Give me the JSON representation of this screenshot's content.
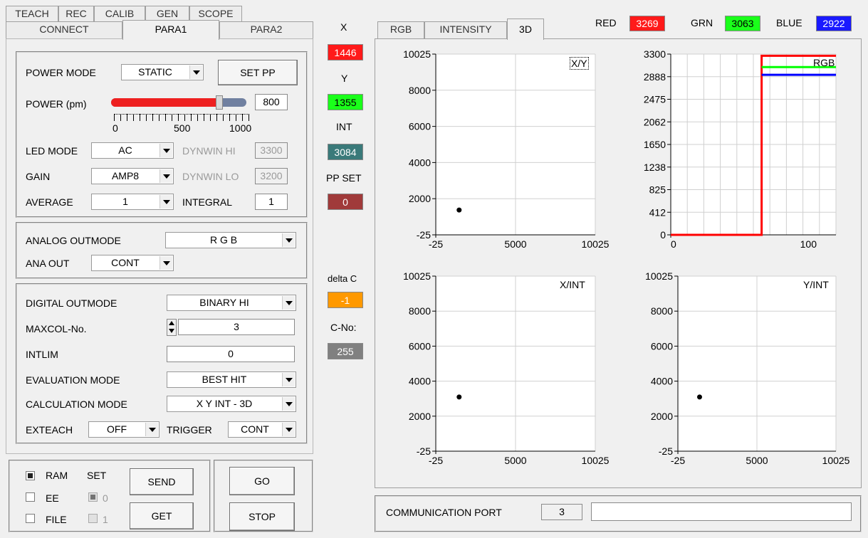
{
  "tabs_top": [
    "TEACH",
    "REC",
    "CALIB",
    "GEN",
    "SCOPE"
  ],
  "tabs_bottom": [
    "CONNECT",
    "PARA1",
    "PARA2"
  ],
  "para1": {
    "power_mode_label": "POWER MODE",
    "power_mode_value": "STATIC",
    "set_pp_label": "SET PP",
    "power_label": "POWER (pm)",
    "power_value": "800",
    "power_fraction": 0.8,
    "slider_ticks": [
      "0",
      "500",
      "1000"
    ],
    "led_mode_label": "LED MODE",
    "led_mode_value": "AC",
    "dynwin_hi_label": "DYNWIN HI",
    "dynwin_hi_value": "3300",
    "gain_label": "GAIN",
    "gain_value": "AMP8",
    "dynwin_lo_label": "DYNWIN LO",
    "dynwin_lo_value": "3200",
    "average_label": "AVERAGE",
    "average_value": "1",
    "integral_label": "INTEGRAL",
    "integral_value": "1"
  },
  "analog": {
    "outmode_label": "ANALOG OUTMODE",
    "outmode_value": "R G B",
    "anaout_label": "ANA OUT",
    "anaout_value": "CONT"
  },
  "digital": {
    "outmode_label": "DIGITAL OUTMODE",
    "outmode_value": "BINARY HI",
    "maxcol_label": "MAXCOL-No.",
    "maxcol_value": "3",
    "intlim_label": "INTLIM",
    "intlim_value": "0",
    "eval_label": "EVALUATION MODE",
    "eval_value": "BEST HIT",
    "calc_label": "CALCULATION MODE",
    "calc_value": "X Y INT - 3D",
    "exteach_label": "EXTEACH",
    "exteach_value": "OFF",
    "trigger_label": "TRIGGER",
    "trigger_value": "CONT"
  },
  "bottom": {
    "ram": "RAM",
    "ee": "EE",
    "file": "FILE",
    "set": "SET",
    "set0": "0",
    "set1": "1",
    "send": "SEND",
    "get": "GET",
    "go": "GO",
    "stop": "STOP"
  },
  "readouts": {
    "x_label": "X",
    "x_value": "1446",
    "y_label": "Y",
    "y_value": "1355",
    "int_label": "INT",
    "int_value": "3084",
    "ppset_label": "PP SET",
    "ppset_value": "0",
    "deltac_label": "delta C",
    "deltac_value": "-1",
    "cno_label": "C-No:",
    "cno_value": "255"
  },
  "right_tabs": [
    "RGB",
    "INTENSITY",
    "3D"
  ],
  "rgb_header": {
    "red_label": "RED",
    "red_value": "3269",
    "grn_label": "GRN",
    "grn_value": "3063",
    "blue_label": "BLUE",
    "blue_value": "2922"
  },
  "colors": {
    "red": "#ff0000",
    "green": "#00ff00",
    "blue": "#0000ff",
    "intbox": "#3a7a7a",
    "ppset": "#a03a3a",
    "deltac": "#ff9900",
    "cno": "#808080"
  },
  "plots": {
    "xy_label": "X/Y",
    "xint_label": "X/INT",
    "yint_label": "Y/INT",
    "rgb_label": "RGB"
  },
  "chart_data": [
    {
      "type": "scatter",
      "title": "X/Y",
      "xlim": [
        -25,
        10025
      ],
      "ylim": [
        -25,
        10025
      ],
      "x_ticks": [
        "-25",
        "5000",
        "10025"
      ],
      "y_ticks": [
        "10025",
        "8000",
        "6000",
        "4000",
        "2000",
        "-25"
      ],
      "points": [
        [
          1446,
          1355
        ]
      ]
    },
    {
      "type": "line",
      "title": "RGB",
      "xlim": [
        0,
        120
      ],
      "ylim": [
        0,
        3300
      ],
      "x_ticks": [
        "0",
        "100"
      ],
      "y_ticks": [
        "3300",
        "2888",
        "2475",
        "2062",
        "1650",
        "1238",
        "825",
        "412",
        "0"
      ],
      "series": [
        {
          "name": "RED",
          "color": "#ff0000",
          "x": [
            0,
            66,
            66,
            120
          ],
          "values": [
            0,
            0,
            3269,
            3269
          ]
        },
        {
          "name": "GRN",
          "color": "#00ff00",
          "x": [
            66,
            120
          ],
          "values": [
            3063,
            3063
          ]
        },
        {
          "name": "BLUE",
          "color": "#0000ff",
          "x": [
            66,
            120
          ],
          "values": [
            2922,
            2922
          ]
        }
      ]
    },
    {
      "type": "scatter",
      "title": "X/INT",
      "xlim": [
        -25,
        10025
      ],
      "ylim": [
        -25,
        10025
      ],
      "x_ticks": [
        "-25",
        "5000",
        "10025"
      ],
      "y_ticks": [
        "10025",
        "8000",
        "6000",
        "4000",
        "2000",
        "-25"
      ],
      "points": [
        [
          1446,
          3084
        ]
      ]
    },
    {
      "type": "scatter",
      "title": "Y/INT",
      "xlim": [
        -25,
        10025
      ],
      "ylim": [
        -25,
        10025
      ],
      "x_ticks": [
        "-25",
        "5000",
        "10025"
      ],
      "y_ticks": [
        "10025",
        "8000",
        "6000",
        "4000",
        "2000",
        "-25"
      ],
      "points": [
        [
          1355,
          3084
        ]
      ]
    }
  ],
  "comm": {
    "label": "COMMUNICATION PORT",
    "port": "3",
    "status": ""
  }
}
